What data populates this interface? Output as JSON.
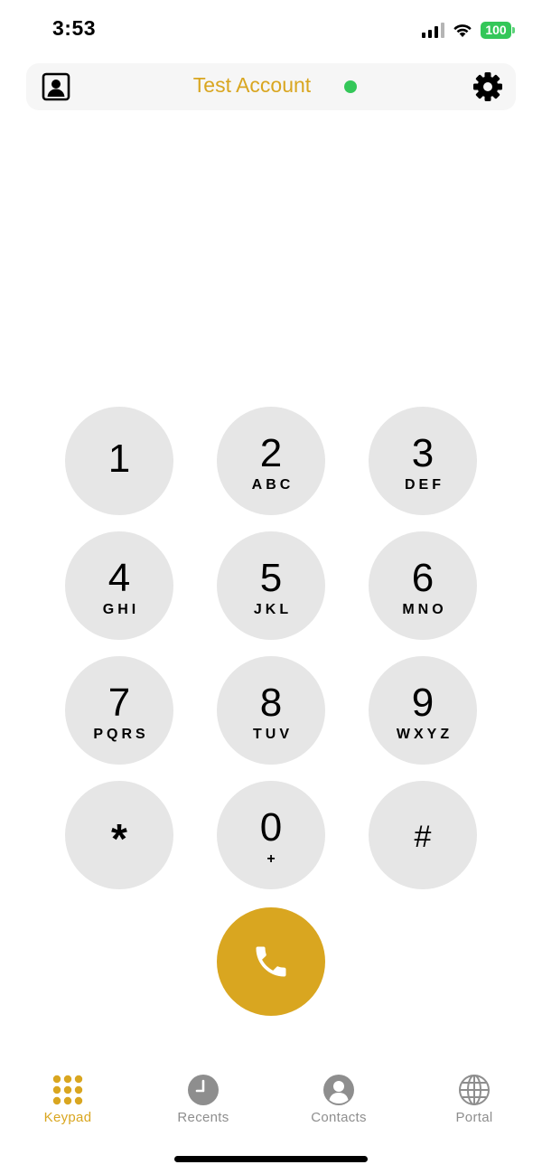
{
  "status": {
    "time": "3:53",
    "battery": "100",
    "signal": "signal-bars-icon",
    "wifi": "wifi-icon"
  },
  "header": {
    "account_name": "Test Account",
    "presence_status": "online",
    "left_icon": "contact-card-icon",
    "right_icon": "gear-icon"
  },
  "keypad": {
    "keys": [
      {
        "digit": "1",
        "letters": ""
      },
      {
        "digit": "2",
        "letters": "ABC"
      },
      {
        "digit": "3",
        "letters": "DEF"
      },
      {
        "digit": "4",
        "letters": "GHI"
      },
      {
        "digit": "5",
        "letters": "JKL"
      },
      {
        "digit": "6",
        "letters": "MNO"
      },
      {
        "digit": "7",
        "letters": "PQRS"
      },
      {
        "digit": "8",
        "letters": "TUV"
      },
      {
        "digit": "9",
        "letters": "WXYZ"
      },
      {
        "digit": "*",
        "letters": ""
      },
      {
        "digit": "0",
        "letters": "+"
      },
      {
        "digit": "#",
        "letters": ""
      }
    ],
    "call_icon": "phone-icon"
  },
  "tabs": [
    {
      "label": "Keypad",
      "icon": "keypad-grid-icon",
      "active": true
    },
    {
      "label": "Recents",
      "icon": "clock-icon",
      "active": false
    },
    {
      "label": "Contacts",
      "icon": "person-circle-icon",
      "active": false
    },
    {
      "label": "Portal",
      "icon": "globe-icon",
      "active": false
    }
  ],
  "colors": {
    "accent": "#d9a620",
    "online": "#34c759",
    "key_background": "#e6e6e6",
    "tab_inactive": "#8e8e8e",
    "header_background": "#f6f6f6"
  }
}
